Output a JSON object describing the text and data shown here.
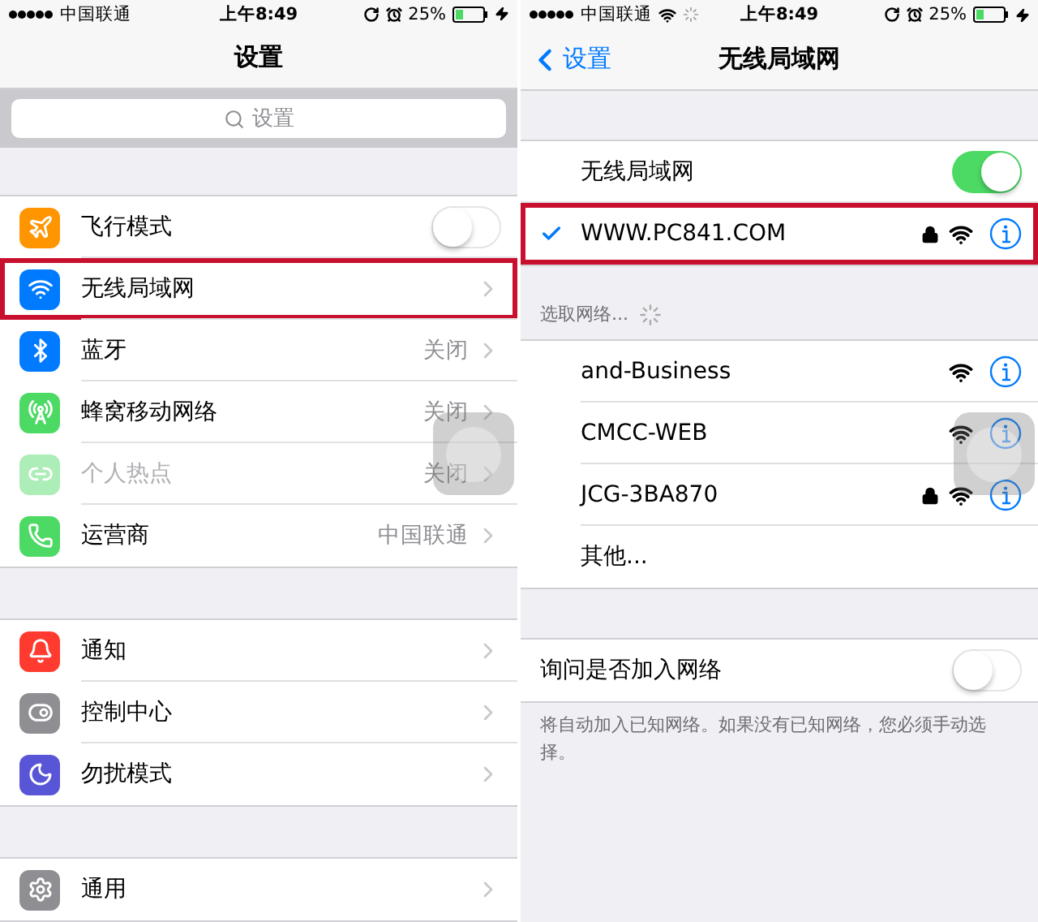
{
  "left": {
    "status_bar": {
      "carrier": "中国联通",
      "time": "上午8:49",
      "battery": "25%"
    },
    "title": "设置",
    "search": {
      "placeholder": "设置"
    },
    "groups": [
      {
        "items": [
          {
            "label": "飞行模式",
            "kind": "toggle",
            "on": false,
            "highlighted": false,
            "disabled": false
          },
          {
            "label": "无线局域网",
            "kind": "link",
            "highlighted": true,
            "disabled": false
          },
          {
            "label": "蓝牙",
            "value": "关闭",
            "kind": "link",
            "highlighted": false,
            "disabled": false
          },
          {
            "label": "蜂窝移动网络",
            "value": "关闭",
            "kind": "link",
            "highlighted": false,
            "disabled": false
          },
          {
            "label": "个人热点",
            "value": "关闭",
            "kind": "link",
            "highlighted": false,
            "disabled": true
          },
          {
            "label": "运营商",
            "value": "中国联通",
            "kind": "link",
            "highlighted": false,
            "disabled": false
          }
        ]
      },
      {
        "items": [
          {
            "label": "通知",
            "kind": "link",
            "highlighted": false,
            "disabled": false
          },
          {
            "label": "控制中心",
            "kind": "link",
            "highlighted": false,
            "disabled": false
          },
          {
            "label": "勿扰模式",
            "kind": "link",
            "highlighted": false,
            "disabled": false
          }
        ]
      },
      {
        "items": [
          {
            "label": "通用",
            "kind": "link",
            "highlighted": false,
            "disabled": false
          }
        ]
      }
    ]
  },
  "right": {
    "status_bar": {
      "carrier": "中国联通",
      "time": "上午8:49",
      "battery": "25%"
    },
    "back": "设置",
    "title": "无线局域网",
    "wifi_toggle": {
      "label": "无线局域网",
      "on": true
    },
    "connected": {
      "name": "WWW.PC841.COM",
      "locked": true,
      "highlighted": true
    },
    "section_header": "选取网络...",
    "networks": [
      {
        "name": "and-Business",
        "locked": false
      },
      {
        "name": "CMCC-WEB",
        "locked": false
      },
      {
        "name": "JCG-3BA870",
        "locked": true
      }
    ],
    "other": "其他...",
    "ask_to_join": {
      "label": "询问是否加入网络",
      "on": false
    },
    "footnote": "将自动加入已知网络。如果没有已知网络，您必须手动选择。"
  }
}
